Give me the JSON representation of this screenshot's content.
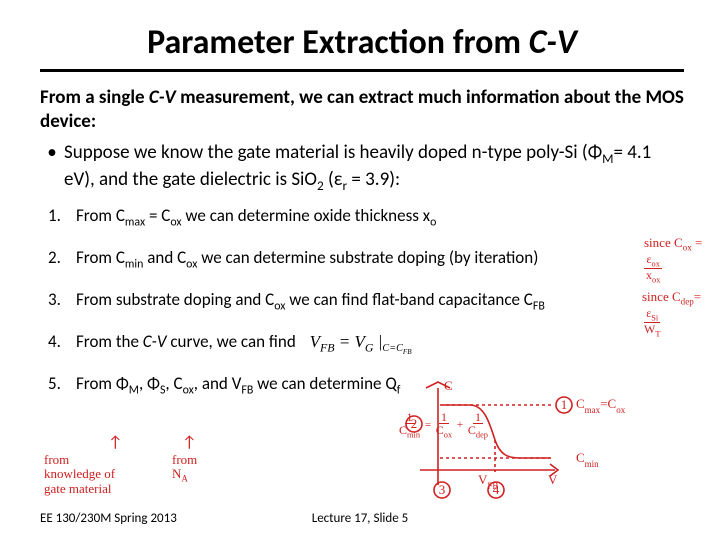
{
  "title_a": "Parameter Extraction from ",
  "title_b": "C-V",
  "intro_a": "From a single ",
  "intro_b": "C-V",
  "intro_c": " measurement, we can extract much information about the MOS device:",
  "bullet_a": "Suppose we know the gate material is heavily doped n-type poly-Si (Φ",
  "bullet_b": "= 4.1 eV), and the gate dielectric is SiO",
  "bullet_c": " (ε",
  "bullet_d": " = 3.9):",
  "items": [
    {
      "n": "1.",
      "t_a": "From C",
      "t_b": " = C",
      "t_c": " we can determine oxide thickness x"
    },
    {
      "n": "2.",
      "t": "From C",
      "t2": " and C",
      "t3": " we can determine substrate doping (by iteration)"
    },
    {
      "n": "3.",
      "t": "From substrate doping and C",
      "t2": " we can find flat-band capacitance C"
    },
    {
      "n": "4.",
      "t_a": "From the ",
      "t_b": "C-V",
      "t_c": " curve, we can find"
    },
    {
      "n": "5.",
      "t": "From Φ",
      "t2": ", Φ",
      "t3": ", C",
      "t4": ", and V",
      "t5": " we can determine Q"
    }
  ],
  "eq4": "V_FB = V_G |_{C=C_FB}",
  "ann": {
    "eq1_pre": "since  C",
    "eq1_sub": "ox",
    "eq1_eq": "=",
    "eq1_top": "ε_ox",
    "eq1_bot": "x_ox",
    "eq2_pre": "since C",
    "eq2_sub": "dep",
    "eq2_eq": "=",
    "eq2_top": "ε_Si",
    "eq2_bot": "W_T",
    "knowledge": "from knowledge of gate material",
    "na": "from N_A",
    "sk": {
      "c": "C",
      "v": "V",
      "one": "1",
      "two": "2",
      "three": "3",
      "four": "4",
      "cmax": "C_max = C_ox",
      "cmin": "C_min",
      "mineq_l": "1",
      "mineq_r": " = ",
      "mineq_a": "1",
      "mineq_b": "C_ox",
      "mineq_c": "1",
      "mineq_d": "C_dep",
      "vfb": "V_FB"
    }
  },
  "footer": {
    "left": "EE 130/230M Spring 2013",
    "center": "Lecture 17, Slide 5"
  }
}
